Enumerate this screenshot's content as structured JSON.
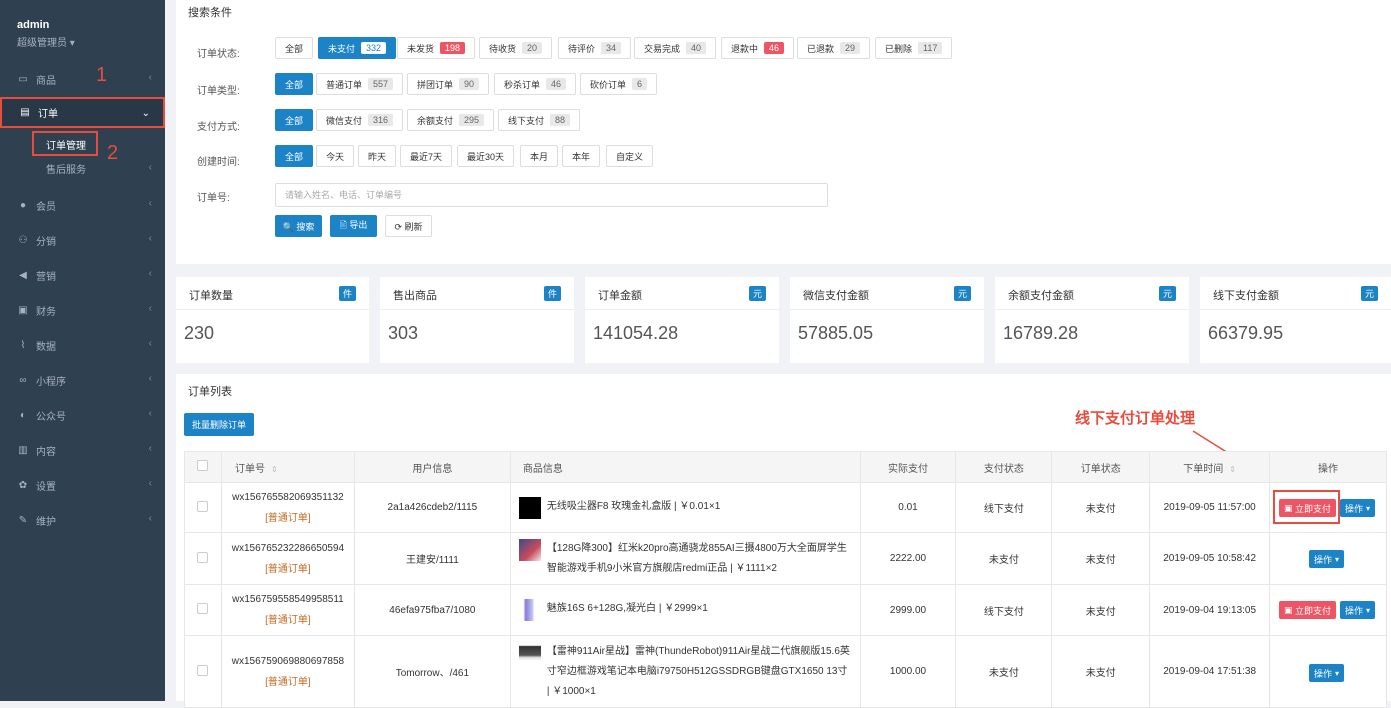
{
  "user": {
    "name": "admin",
    "role": "超级管理员 ▾"
  },
  "sidebar": {
    "items": [
      {
        "label": "商品",
        "icon": "▭"
      },
      {
        "label": "订单",
        "icon": "▤"
      },
      {
        "label": "会员",
        "icon": "●"
      },
      {
        "label": "分销",
        "icon": "⚇"
      },
      {
        "label": "营销",
        "icon": "◀"
      },
      {
        "label": "财务",
        "icon": "▣"
      },
      {
        "label": "数据",
        "icon": "⌇"
      },
      {
        "label": "小程序",
        "icon": "∞"
      },
      {
        "label": "公众号",
        "icon": "◐"
      },
      {
        "label": "内容",
        "icon": "▥"
      },
      {
        "label": "设置",
        "icon": "✿"
      },
      {
        "label": "维护",
        "icon": "✎"
      }
    ],
    "sub": [
      {
        "label": "订单管理"
      },
      {
        "label": "售后服务"
      }
    ],
    "marks": {
      "one": "1",
      "two": "2"
    }
  },
  "search": {
    "title": "搜索条件",
    "status_label": "订单状态:",
    "type_label": "订单类型:",
    "pay_label": "支付方式:",
    "time_label": "创建时间:",
    "no_label": "订单号:",
    "placeholder": "请输入姓名、电话、订单编号",
    "status": [
      {
        "label": "全部"
      },
      {
        "label": "未支付",
        "count": "332"
      },
      {
        "label": "未发货",
        "count": "198"
      },
      {
        "label": "待收货",
        "count": "20"
      },
      {
        "label": "待评价",
        "count": "34"
      },
      {
        "label": "交易完成",
        "count": "40"
      },
      {
        "label": "退款中",
        "count": "46"
      },
      {
        "label": "已退款",
        "count": "29"
      },
      {
        "label": "已删除",
        "count": "117"
      }
    ],
    "types": [
      {
        "label": "全部"
      },
      {
        "label": "普通订单",
        "count": "557"
      },
      {
        "label": "拼团订单",
        "count": "90"
      },
      {
        "label": "秒杀订单",
        "count": "46"
      },
      {
        "label": "砍价订单",
        "count": "6"
      }
    ],
    "pays": [
      {
        "label": "全部"
      },
      {
        "label": "微信支付",
        "count": "316"
      },
      {
        "label": "余额支付",
        "count": "295"
      },
      {
        "label": "线下支付",
        "count": "88"
      }
    ],
    "times": [
      {
        "label": "全部"
      },
      {
        "label": "今天"
      },
      {
        "label": "昨天"
      },
      {
        "label": "最近7天"
      },
      {
        "label": "最近30天"
      },
      {
        "label": "本月"
      },
      {
        "label": "本年"
      },
      {
        "label": "自定义"
      }
    ],
    "btn_search": "🔍 搜索",
    "btn_export": "🖹 导出",
    "btn_refresh": "⟳ 刷新"
  },
  "stats": [
    {
      "title": "订单数量",
      "badge": "件",
      "value": "230"
    },
    {
      "title": "售出商品",
      "badge": "件",
      "value": "303"
    },
    {
      "title": "订单金额",
      "badge": "元",
      "value": "141054.28"
    },
    {
      "title": "微信支付金额",
      "badge": "元",
      "value": "57885.05"
    },
    {
      "title": "余额支付金额",
      "badge": "元",
      "value": "16789.28"
    },
    {
      "title": "线下支付金额",
      "badge": "元",
      "value": "66379.95"
    }
  ],
  "list": {
    "title": "订单列表",
    "batch_delete": "批量删除订单",
    "note": "线下支付订单处理",
    "columns": {
      "no": "订单号",
      "user": "用户信息",
      "goods": "商品信息",
      "pay": "实际支付",
      "pay_status": "支付状态",
      "order_status": "订单状态",
      "time": "下单时间",
      "op": "操作"
    },
    "pay_now": "立即支付",
    "op_btn": "操作",
    "rows": [
      {
        "no": "wx156765582069351132",
        "type": "[普通订单]",
        "user": "2a1a426cdeb2/1115",
        "goods": "无线吸尘器F8 玫瑰金礼盒版 | ￥0.01×1",
        "pay": "0.01",
        "pay_status": "线下支付",
        "order_status": "未支付",
        "time": "2019-09-05 11:57:00",
        "show_pay": true
      },
      {
        "no": "wx156765232286650594",
        "type": "[普通订单]",
        "user": "王建安/1111",
        "goods": "【128G降300】红米k20pro高通骁龙855AI三摄4800万大全面屏学生智能游戏手机9小米官方旗舰店redmi正品 | ￥1111×2",
        "pay": "2222.00",
        "pay_status": "未支付",
        "order_status": "未支付",
        "time": "2019-09-05 10:58:42",
        "show_pay": false
      },
      {
        "no": "wx156759558549958511",
        "type": "[普通订单]",
        "user": "46efa975fba7/1080",
        "goods": "魅族16S 6+128G,凝光白 | ￥2999×1",
        "pay": "2999.00",
        "pay_status": "线下支付",
        "order_status": "未支付",
        "time": "2019-09-04 19:13:05",
        "show_pay": true
      },
      {
        "no": "wx156759069880697858",
        "type": "[普通订单]",
        "user": "Tomorrow、/461",
        "goods": "【雷神911Air星战】雷神(ThundeRobot)911Air星战二代旗舰版15.6英寸窄边框游戏笔记本电脑i79750H512GSSDRGB键盘GTX1650 13寸 | ￥1000×1",
        "pay": "1000.00",
        "pay_status": "未支付",
        "order_status": "未支付",
        "time": "2019-09-04 17:51:38",
        "show_pay": false
      }
    ]
  },
  "colors": {
    "sidebar": "#2f4050",
    "primary": "#1c84c6",
    "danger": "#ed5565",
    "annotation": "#e74c3c"
  }
}
